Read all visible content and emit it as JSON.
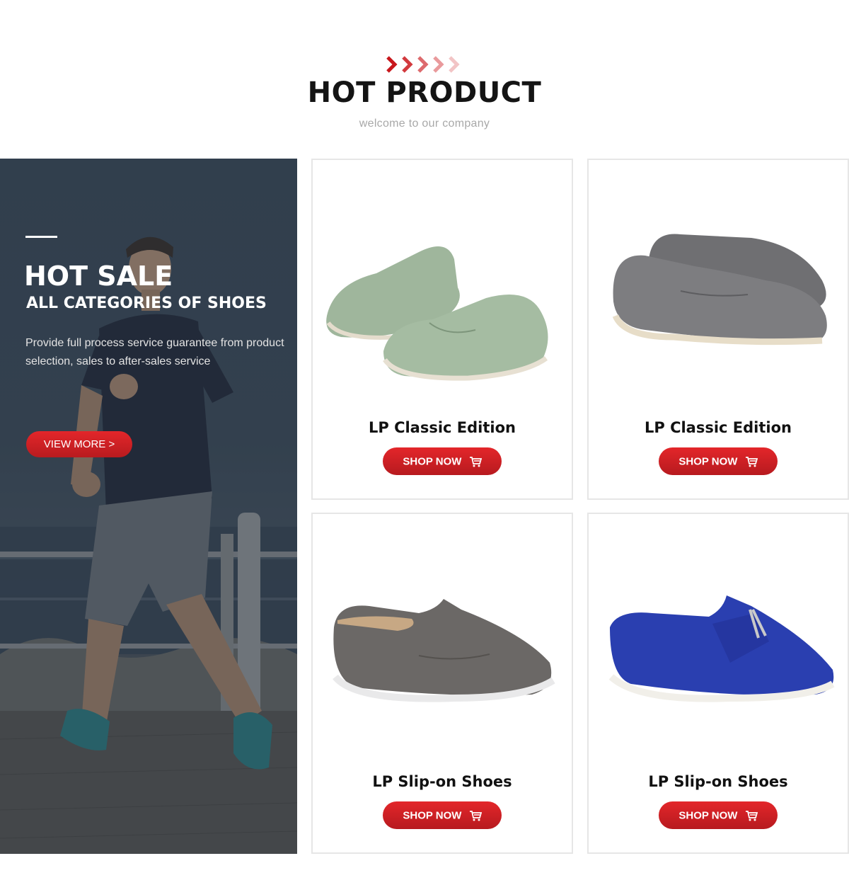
{
  "header": {
    "title": "HOT PRODUCT",
    "subtitle": "welcome to our company",
    "accent_color": "#c8171c"
  },
  "promo": {
    "title": "HOT SALE",
    "subtitle": "ALL CATEGORIES OF SHOES",
    "description": "Provide full process service guarantee from product selection, sales to after-sales service",
    "button_label": "VIEW MORE >"
  },
  "products": [
    {
      "name": "LP Classic Edition",
      "button_label": "SHOP NOW",
      "color": "#9cb49a"
    },
    {
      "name": "LP Classic Edition",
      "button_label": "SHOP NOW",
      "color": "#7a7a7c"
    },
    {
      "name": "LP Slip-on Shoes",
      "button_label": "SHOP NOW",
      "color": "#6b6866"
    },
    {
      "name": "LP Slip-on Shoes",
      "button_label": "SHOP NOW",
      "color": "#2a3fb0"
    }
  ],
  "icons": [
    "chevron-arrows-icon",
    "cart-icon"
  ]
}
